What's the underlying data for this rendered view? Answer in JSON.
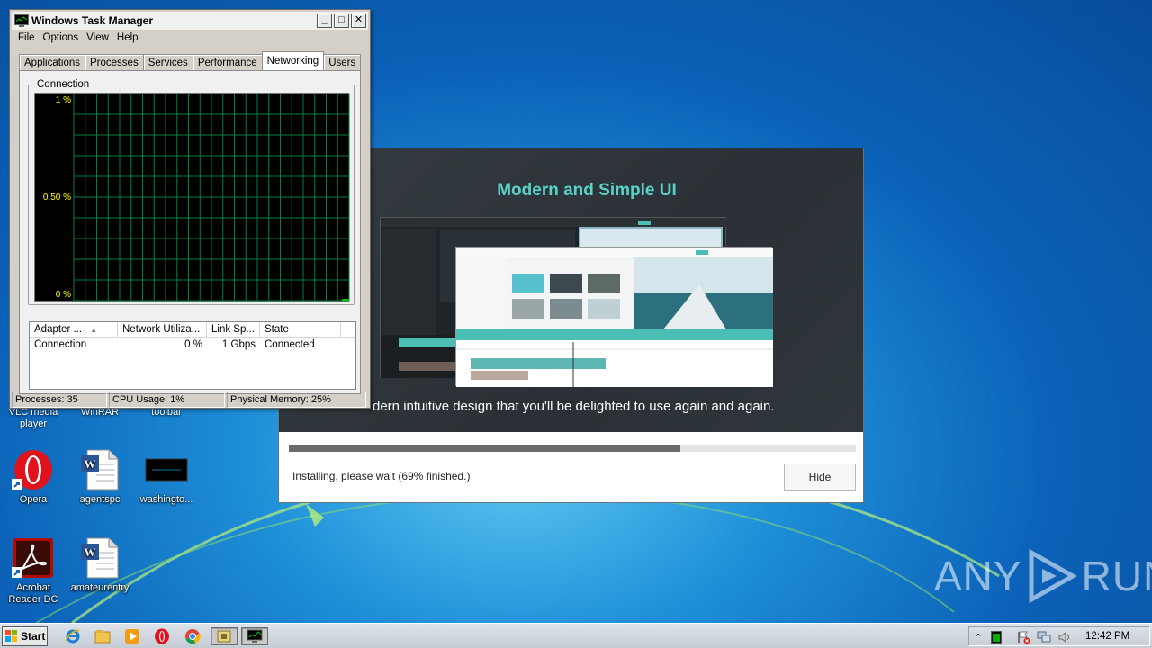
{
  "task_manager": {
    "title": "Windows Task Manager",
    "menu": [
      "File",
      "Options",
      "View",
      "Help"
    ],
    "tabs": [
      "Applications",
      "Processes",
      "Services",
      "Performance",
      "Networking",
      "Users"
    ],
    "active_tab": "Networking",
    "group_label": "Connection",
    "graph": {
      "y_top": "1 %",
      "y_mid": "0.50 %",
      "y_bottom": "0 %",
      "line_color": "#00c000",
      "grid_color": "#008040"
    },
    "adapter_table": {
      "columns": [
        "Adapter ...",
        "Network Utiliza...",
        "Link Sp...",
        "State"
      ],
      "rows": [
        {
          "adapter": "Connection",
          "utilization": "0 %",
          "link_speed": "1 Gbps",
          "state": "Connected"
        }
      ]
    },
    "status": {
      "processes": "Processes: 35",
      "cpu": "CPU Usage: 1%",
      "memory": "Physical Memory: 25%"
    }
  },
  "installer": {
    "title": "Modern and Simple UI",
    "subtitle": "dern intuitive design that you'll be delighted to use again and again.",
    "progress_fraction": 0.69,
    "status_text": "Installing, please wait (69% finished.)",
    "hide_button": "Hide",
    "accent_color": "#57d3c9"
  },
  "desktop": {
    "partial_labels": {
      "vlc": "VLC media player",
      "winrar": "WinRAR",
      "toolbar": "toolbar"
    },
    "icons": [
      {
        "label": "Opera",
        "icon": "opera-icon"
      },
      {
        "label": "agentspc",
        "icon": "word-document-icon"
      },
      {
        "label": "washingto...",
        "icon": "black-image-icon"
      },
      {
        "label": "Acrobat Reader DC",
        "icon": "acrobat-icon"
      },
      {
        "label": "amateurentry",
        "icon": "word-document-icon"
      }
    ]
  },
  "taskbar": {
    "start_label": "Start",
    "clock": "12:42 PM",
    "pinned": [
      "ie-icon",
      "explorer-icon",
      "media-player-icon",
      "opera-icon",
      "chrome-icon",
      "installer-icon",
      "task-manager-icon"
    ]
  },
  "watermark": {
    "left": "ANY",
    "right": "RUN"
  }
}
